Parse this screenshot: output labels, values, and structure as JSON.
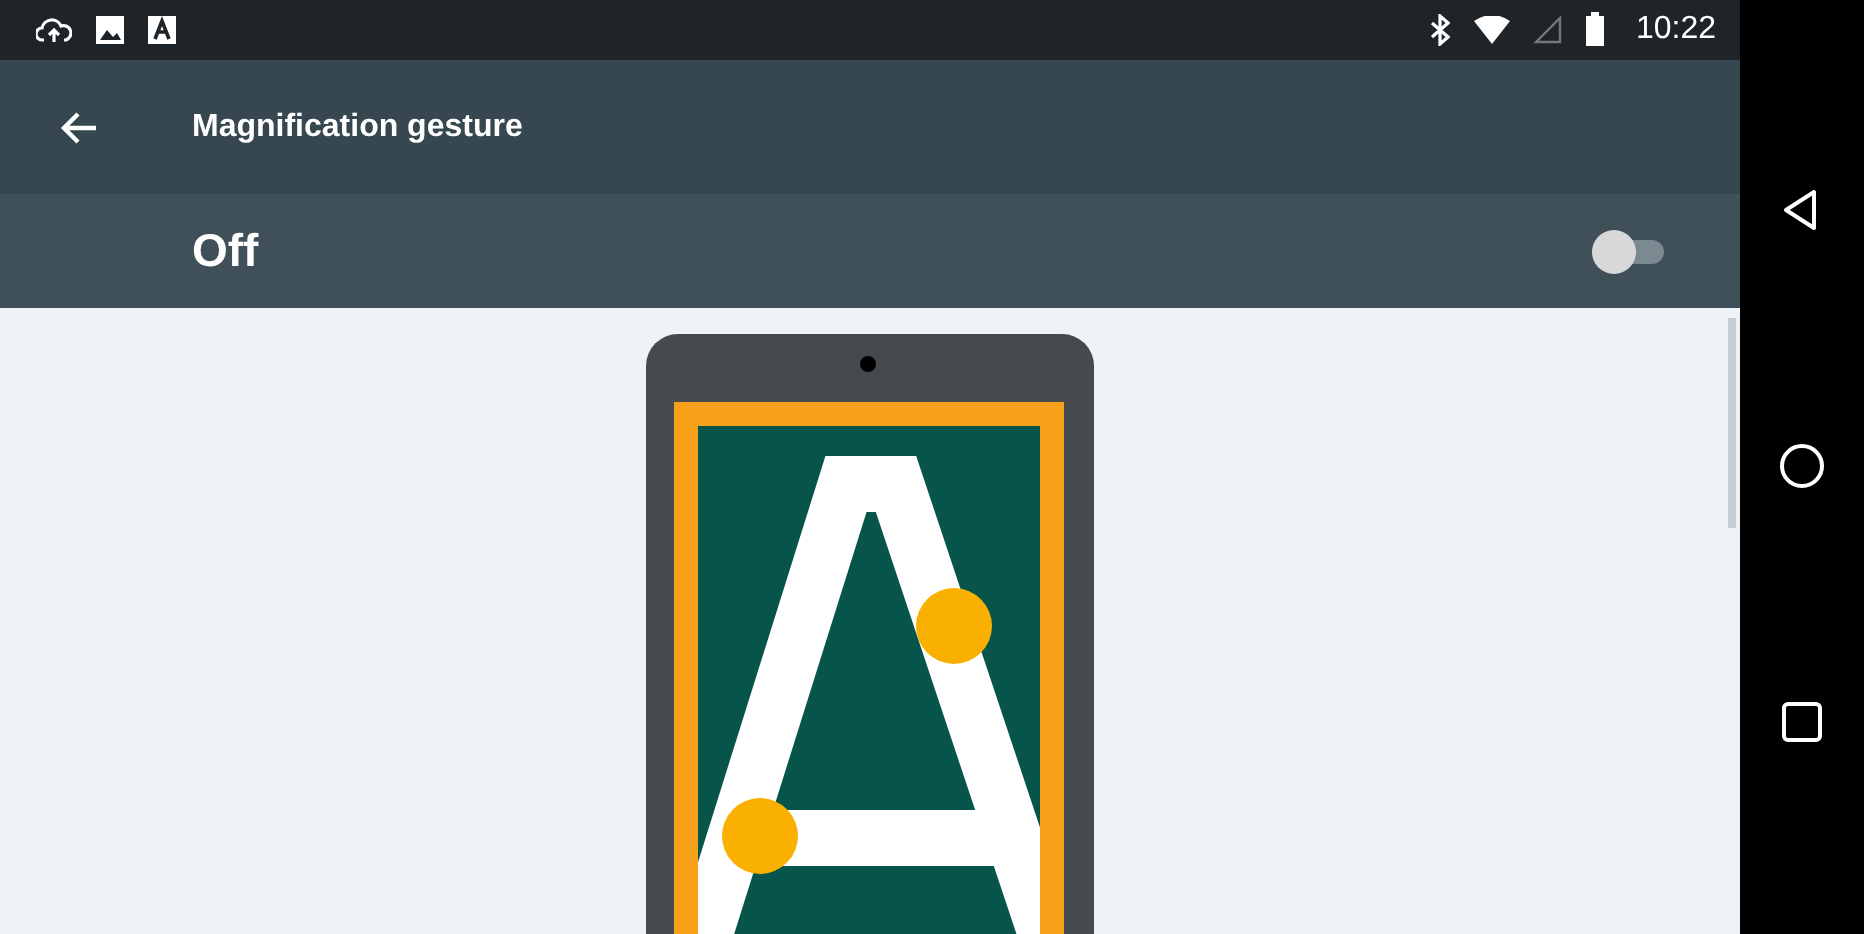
{
  "status_bar": {
    "time": "10:22"
  },
  "toolbar": {
    "title": "Magnification gesture"
  },
  "master_switch": {
    "label": "Off",
    "on": false
  }
}
